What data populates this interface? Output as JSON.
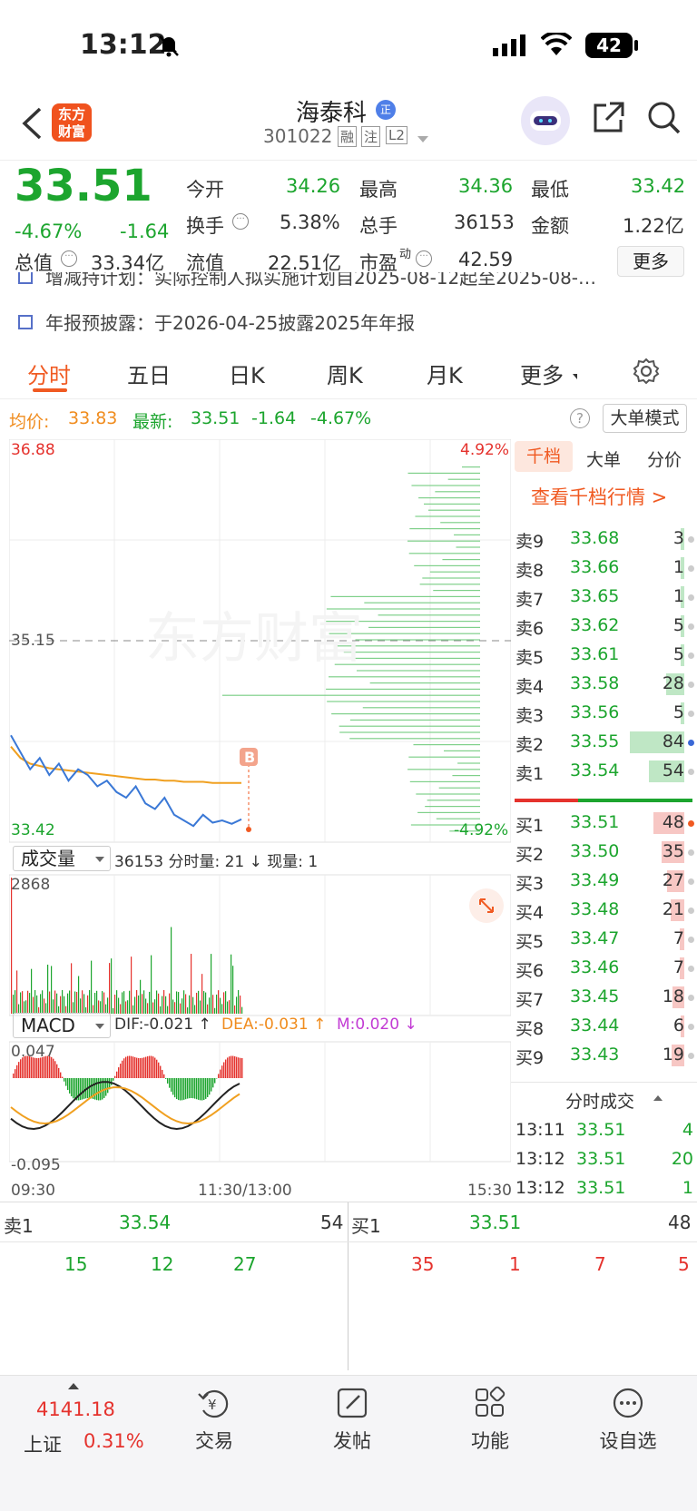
{
  "status": {
    "time": "13:12",
    "battery": "42"
  },
  "header": {
    "logo_line1": "东方",
    "logo_line2": "财富",
    "name": "海泰科",
    "name_badge": "正",
    "code": "301022",
    "tags": [
      "融",
      "注",
      "L2"
    ]
  },
  "quote": {
    "price": "33.51",
    "change_pct": "-4.67%",
    "change": "-1.64",
    "fields": [
      {
        "label": "今开",
        "value": "34.26"
      },
      {
        "label": "最高",
        "value": "34.36"
      },
      {
        "label": "最低",
        "value": "33.42"
      },
      {
        "label": "换手",
        "value": "5.38%"
      },
      {
        "label": "总手",
        "value": "36153"
      },
      {
        "label": "金额",
        "value": "1.22亿"
      },
      {
        "label": "总值",
        "value": "33.34亿"
      },
      {
        "label": "流值",
        "value": "22.51亿"
      },
      {
        "label": "市盈",
        "value": "42.59",
        "sup": "动"
      }
    ],
    "more_label": "更多"
  },
  "notices": [
    "增减持计划：实际控制人拟实施计划自2025-08-12起至2025-08-…",
    "年报预披露：于2026-04-25披露2025年年报"
  ],
  "tabs": [
    "分时",
    "五日",
    "日K",
    "周K",
    "月K",
    "更多"
  ],
  "infoline": {
    "avg_label": "均价:",
    "avg_value": "33.83",
    "latest_label": "最新:",
    "latest_value": "33.51",
    "change": "-1.64",
    "change_pct": "-4.67%",
    "big_order_mode": "大单模式"
  },
  "chart": {
    "price_high": "36.88",
    "price_mid": "35.15",
    "price_low": "33.42",
    "pct_high": "4.92%",
    "pct_low": "-4.92%",
    "watermark": "东方财富",
    "trade_marker": "B",
    "volume_selector": "成交量",
    "volume_info": "36153 分时量: 21 ↓ 现量: 1",
    "volume_info_tail": "1",
    "volume_max": "2868",
    "macd_selector": "MACD",
    "dif": "DIF:-0.021 ↑",
    "dea": "DEA:-0.031 ↑",
    "m": "M:0.020 ↓",
    "macd_top": "0.047",
    "macd_bottom": "-0.095",
    "time_start": "09:30",
    "time_mid": "11:30/13:00",
    "time_end": "15:30"
  },
  "chart_data": {
    "type": "line",
    "series": [
      {
        "name": "",
        "values": [
          34.25,
          34.1,
          33.95,
          34.05,
          33.9,
          34.0,
          33.85,
          33.95,
          33.9,
          33.8,
          33.85,
          33.75,
          33.7,
          33.8,
          33.65,
          33.6,
          33.7,
          33.55,
          33.5,
          33.45,
          33.55,
          33.48,
          33.5,
          33.47,
          33.51
        ]
      },
      {
        "name": "均价",
        "values": [
          34.15,
          34.05,
          34.0,
          33.98,
          33.96,
          33.95,
          33.94,
          33.93,
          33.92,
          33.91,
          33.9,
          33.89,
          33.88,
          33.87,
          33.86,
          33.86,
          33.85,
          33.85,
          33.84,
          33.84,
          33.84,
          33.83,
          33.83,
          33.83,
          33.83
        ]
      }
    ],
    "ylim": [
      33.42,
      36.88
    ]
  },
  "book": {
    "tabs": [
      "千档",
      "大单",
      "分价"
    ],
    "link": "查看千档行情 >",
    "asks": [
      {
        "label": "卖9",
        "price": "33.68",
        "vol": "3"
      },
      {
        "label": "卖8",
        "price": "33.66",
        "vol": "1"
      },
      {
        "label": "卖7",
        "price": "33.65",
        "vol": "1"
      },
      {
        "label": "卖6",
        "price": "33.62",
        "vol": "5"
      },
      {
        "label": "卖5",
        "price": "33.61",
        "vol": "5"
      },
      {
        "label": "卖4",
        "price": "33.58",
        "vol": "28"
      },
      {
        "label": "卖3",
        "price": "33.56",
        "vol": "5"
      },
      {
        "label": "卖2",
        "price": "33.55",
        "vol": "84"
      },
      {
        "label": "卖1",
        "price": "33.54",
        "vol": "54"
      }
    ],
    "bids": [
      {
        "label": "买1",
        "price": "33.51",
        "vol": "48"
      },
      {
        "label": "买2",
        "price": "33.50",
        "vol": "35"
      },
      {
        "label": "买3",
        "price": "33.49",
        "vol": "27"
      },
      {
        "label": "买4",
        "price": "33.48",
        "vol": "21"
      },
      {
        "label": "买5",
        "price": "33.47",
        "vol": "7"
      },
      {
        "label": "买6",
        "price": "33.46",
        "vol": "7"
      },
      {
        "label": "买7",
        "price": "33.45",
        "vol": "18"
      },
      {
        "label": "买8",
        "price": "33.44",
        "vol": "6"
      },
      {
        "label": "买9",
        "price": "33.43",
        "vol": "19"
      }
    ],
    "trades_title": "分时成交",
    "trades": [
      {
        "time": "13:11",
        "price": "33.51",
        "vol": "4"
      },
      {
        "time": "13:12",
        "price": "33.51",
        "vol": "20"
      },
      {
        "time": "13:12",
        "price": "33.51",
        "vol": "1"
      }
    ]
  },
  "bottom": {
    "ask_label": "卖1",
    "ask_price": "33.54",
    "ask_vol": "54",
    "bid_label": "买1",
    "bid_price": "33.51",
    "bid_vol": "48",
    "ask_queue": [
      "15",
      "12",
      "27"
    ],
    "bid_queue": [
      "35",
      "1",
      "7",
      "5"
    ]
  },
  "tabbar": {
    "index_value": "4141.18",
    "index_name": "上证",
    "index_pct": "0.31%",
    "items": [
      "交易",
      "发帖",
      "功能",
      "设自选"
    ]
  }
}
